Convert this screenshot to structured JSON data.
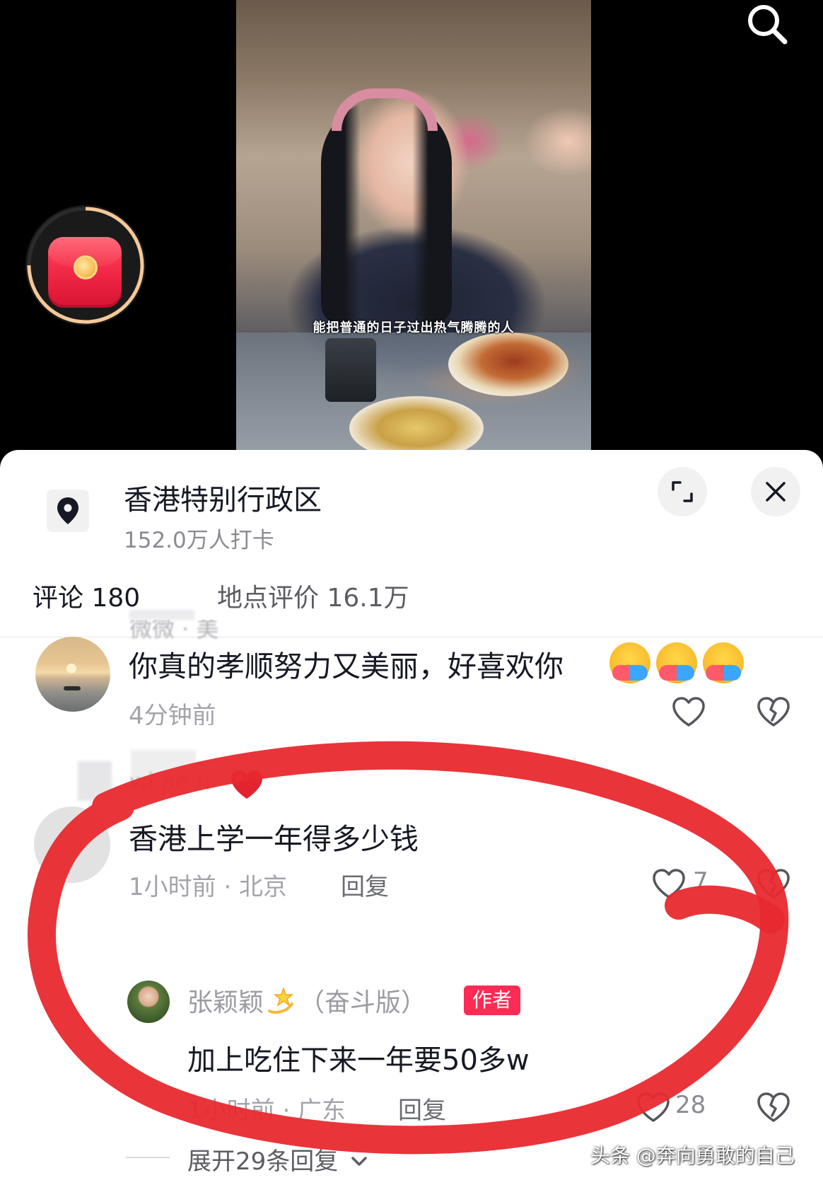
{
  "video": {
    "subtitle": "能把普通的日子过出热气腾腾的人"
  },
  "location": {
    "title": "香港特别行政区",
    "checkins": "152.0万人打卡"
  },
  "tabs": {
    "comments": "评论 180",
    "reviews": "地点评价 16.1万"
  },
  "comments": [
    {
      "username_partial": "微微 · 美",
      "text": "你真的孝顺努力又美丽，好喜欢你",
      "time_partial": "4分钟前"
    },
    {
      "username_partial": "wi ae h",
      "text": "香港上学一年得多少钱",
      "time": "1小时前 · 北京",
      "reply_label": "回复",
      "likes": "7",
      "reply": {
        "username": "张颖颖",
        "username_suffix": "（奋斗版）",
        "badge": "作者",
        "text": "加上吃住下来一年要50多w",
        "time": "1小时前 · 广东",
        "reply_label": "回复",
        "likes": "28"
      },
      "expand_label": "展开29条回复"
    }
  ],
  "watermark": "头条 @奔向勇敢的自己",
  "icons": {
    "search": "search-icon",
    "red_packet": "red-packet-icon",
    "location": "location-pin-icon",
    "expand": "expand-icon",
    "close": "close-icon",
    "like": "heart-outline-icon",
    "dislike": "broken-heart-icon",
    "hug_emoji": "hugging-face-emoji",
    "sparkle_emoji": "dizzy-star-emoji",
    "red_heart_emoji": "red-heart-emoji"
  },
  "colors": {
    "accent": "#fe2c55",
    "annotation_circle": "#e8292f",
    "text_primary": "#161823",
    "text_secondary": "#a3a4aa"
  }
}
